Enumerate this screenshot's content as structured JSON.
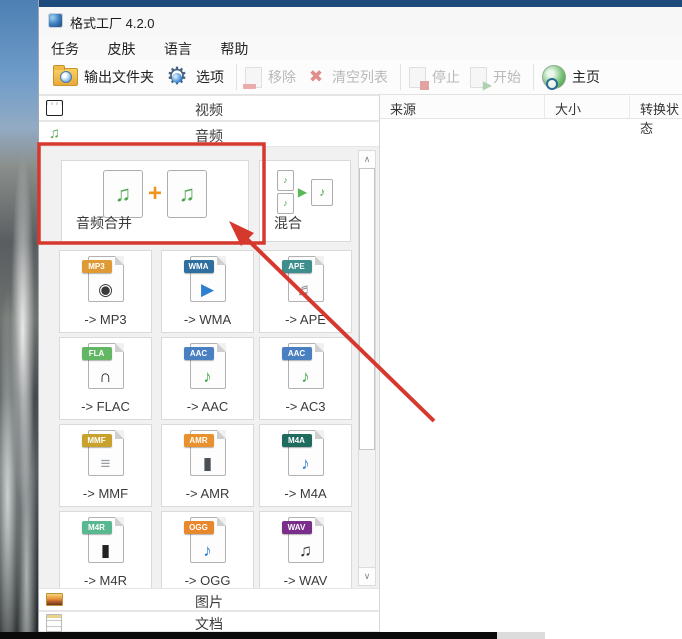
{
  "window": {
    "title": "格式工厂 4.2.0"
  },
  "menu": {
    "items": [
      "任务",
      "皮肤",
      "语言",
      "帮助"
    ]
  },
  "toolbar": {
    "output_folder": "输出文件夹",
    "options": "选项",
    "remove": "移除",
    "clear_list": "清空列表",
    "stop": "停止",
    "start": "开始",
    "home": "主页"
  },
  "sidebar": {
    "video": "视频",
    "audio": "音频",
    "picture": "图片",
    "document": "文档"
  },
  "audio_panel": {
    "merge": {
      "label": "音频合并"
    },
    "mix": {
      "label": "混合"
    },
    "converters": [
      {
        "label": "-> MP3",
        "badge": "MP3",
        "badge_color": "#e09a35",
        "glyph": "◉",
        "glyph_color": "#3a3a3a"
      },
      {
        "label": "-> WMA",
        "badge": "WMA",
        "badge_color": "#2e6f9f",
        "glyph": "▶",
        "glyph_color": "#2f7fd0"
      },
      {
        "label": "-> APE",
        "badge": "APE",
        "badge_color": "#3f8e8e",
        "glyph": "♬",
        "glyph_color": "#8a8f94"
      },
      {
        "label": "-> FLAC",
        "badge": "FLA",
        "badge_color": "#63b663",
        "glyph": "∩",
        "glyph_color": "#222222"
      },
      {
        "label": "-> AAC",
        "badge": "AAC",
        "badge_color": "#4a7fc1",
        "glyph": "♪",
        "glyph_color": "#4aa64a"
      },
      {
        "label": "-> AC3",
        "badge": "AAC",
        "badge_color": "#4a7fc1",
        "glyph": "♪",
        "glyph_color": "#4aa64a"
      },
      {
        "label": "-> MMF",
        "badge": "MMF",
        "badge_color": "#c9a22b",
        "glyph": "≡",
        "glyph_color": "#9aa0a6"
      },
      {
        "label": "-> AMR",
        "badge": "AMR",
        "badge_color": "#e8912d",
        "glyph": "▮",
        "glyph_color": "#4a4f54"
      },
      {
        "label": "-> M4A",
        "badge": "M4A",
        "badge_color": "#1f6b5e",
        "glyph": "♪",
        "glyph_color": "#3a7ad0"
      },
      {
        "label": "-> M4R",
        "badge": "M4R",
        "badge_color": "#58b890",
        "glyph": "▮",
        "glyph_color": "#222222"
      },
      {
        "label": "-> OGG",
        "badge": "OGG",
        "badge_color": "#e8882d",
        "glyph": "♪",
        "glyph_color": "#2f7fd0"
      },
      {
        "label": "-> WAV",
        "badge": "WAV",
        "badge_color": "#7b2d8b",
        "glyph": "♫",
        "glyph_color": "#333333"
      }
    ]
  },
  "file_table": {
    "columns": [
      "来源",
      "大小",
      "转换状态"
    ]
  },
  "annotation": {
    "color": "#d6382e"
  }
}
